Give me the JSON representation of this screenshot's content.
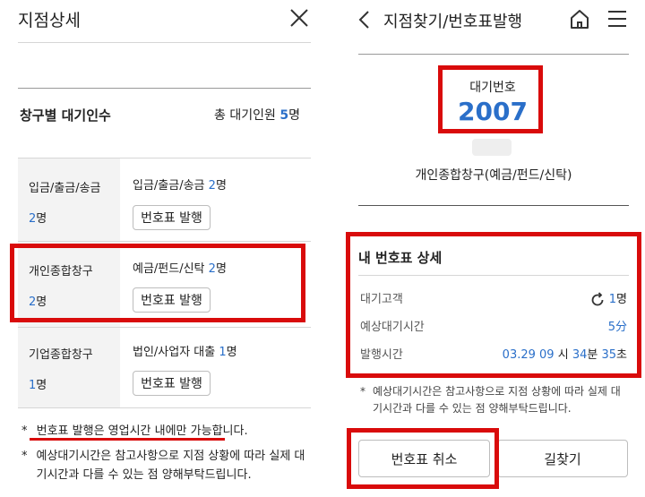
{
  "left": {
    "title": "지점상세",
    "section_title": "창구별 대기인수",
    "total_label": "총 대기인원",
    "total_value": "5",
    "total_unit": "명",
    "rows": [
      {
        "name": "입금/출금/송금",
        "count": "2",
        "unit": "명",
        "detail_name": "입금/출금/송금",
        "detail_count": "2",
        "detail_unit": "명",
        "button": "번호표 발행"
      },
      {
        "name": "개인종합창구",
        "count": "2",
        "unit": "명",
        "detail_name": "예금/펀드/신탁",
        "detail_count": "2",
        "detail_unit": "명",
        "button": "번호표 발행"
      },
      {
        "name": "기업종합창구",
        "count": "1",
        "unit": "명",
        "detail_name": "법인/사업자 대출",
        "detail_count": "1",
        "detail_unit": "명",
        "button": "번호표 발행"
      }
    ],
    "notes": [
      "번호표 발행은 영업시간 내에만 가능합니다.",
      "예상대기시간은 참고사항으로 지점 상황에 따라 실제 대기시간과 다를 수 있는 점 양해부탁드립니다."
    ],
    "note_mark": "*"
  },
  "right": {
    "title": "지점찾기/번호표발행",
    "wait_label": "대기번호",
    "wait_number": "2007",
    "window_name": "개인종합창구(예금/펀드/신탁)",
    "detail_title": "내 번호표 상세",
    "customers_label": "대기고객",
    "customers_value": "1",
    "customers_unit": "명",
    "expected_label": "예상대기시간",
    "expected_value": "5",
    "expected_unit": "分",
    "issued_label": "발행시간",
    "issued_date": "03.29",
    "issued_h": "09",
    "issued_h_unit": "시",
    "issued_m": "34",
    "issued_m_unit": "분",
    "issued_s": "35",
    "issued_s_unit": "초",
    "note": "예상대기시간은 참고사항으로 지점 상황에 따라 실제 대기시간과 다를 수 있는 점 양해부탁드립니다.",
    "note_mark": "*",
    "cancel_button": "번호표 취소",
    "directions_button": "길찾기"
  },
  "colors": {
    "accent": "#2a6fc9",
    "highlight": "#d90b0b"
  }
}
